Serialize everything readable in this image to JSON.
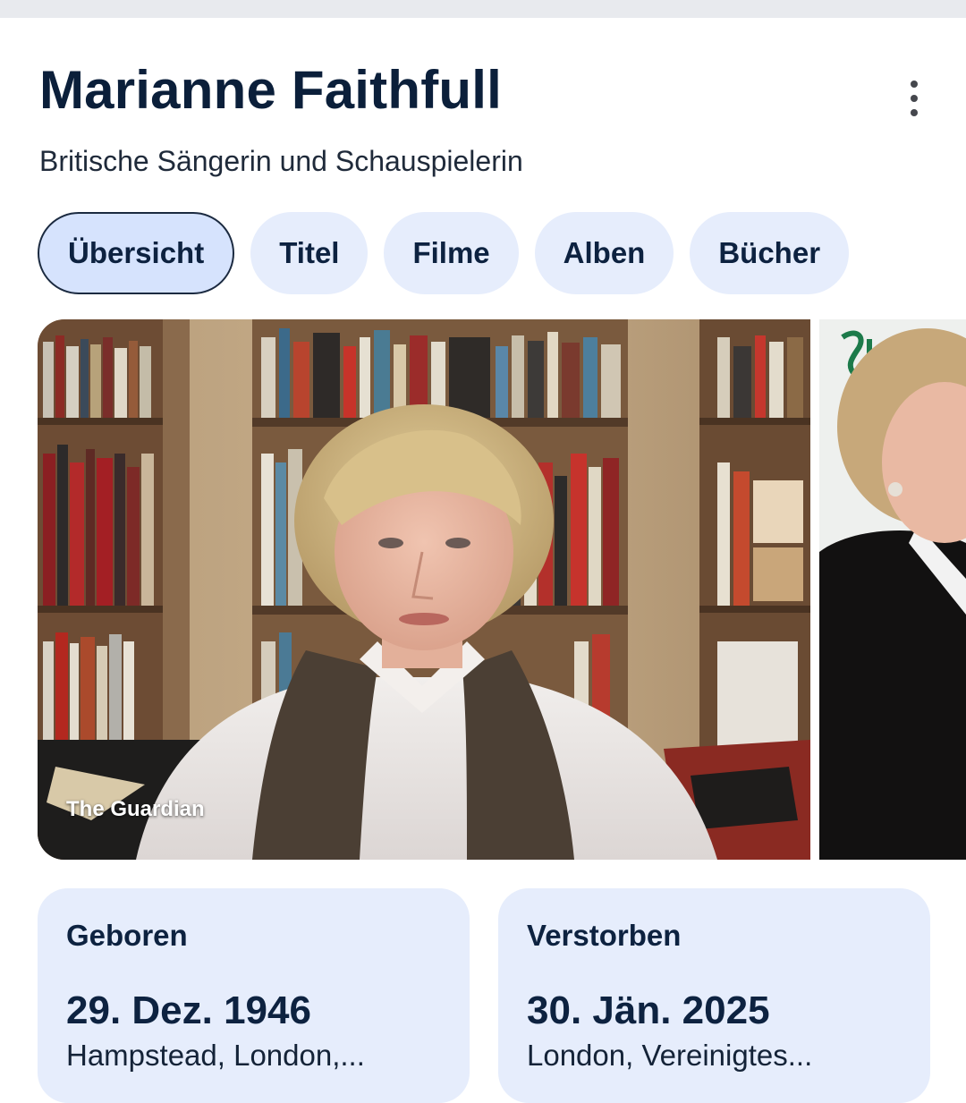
{
  "entity": {
    "title": "Marianne Faithfull",
    "subtitle": "Britische Sängerin und Schauspielerin",
    "more_icon": "more-vert-icon"
  },
  "tabs": [
    {
      "label": "Übersicht",
      "active": true
    },
    {
      "label": "Titel",
      "active": false
    },
    {
      "label": "Filme",
      "active": false
    },
    {
      "label": "Alben",
      "active": false
    },
    {
      "label": "Bücher",
      "active": false
    }
  ],
  "images": {
    "main_source": "The Guardian"
  },
  "facts": {
    "born": {
      "label": "Geboren",
      "date": "29. Dez. 1946",
      "place": "Hampstead, London,..."
    },
    "died": {
      "label": "Verstorben",
      "date": "30. Jän. 2025",
      "place": "London, Vereinigtes..."
    }
  },
  "colors": {
    "chip_bg": "#e6edfc",
    "chip_active_bg": "#d6e3fd",
    "title_color": "#0b1f3a"
  }
}
